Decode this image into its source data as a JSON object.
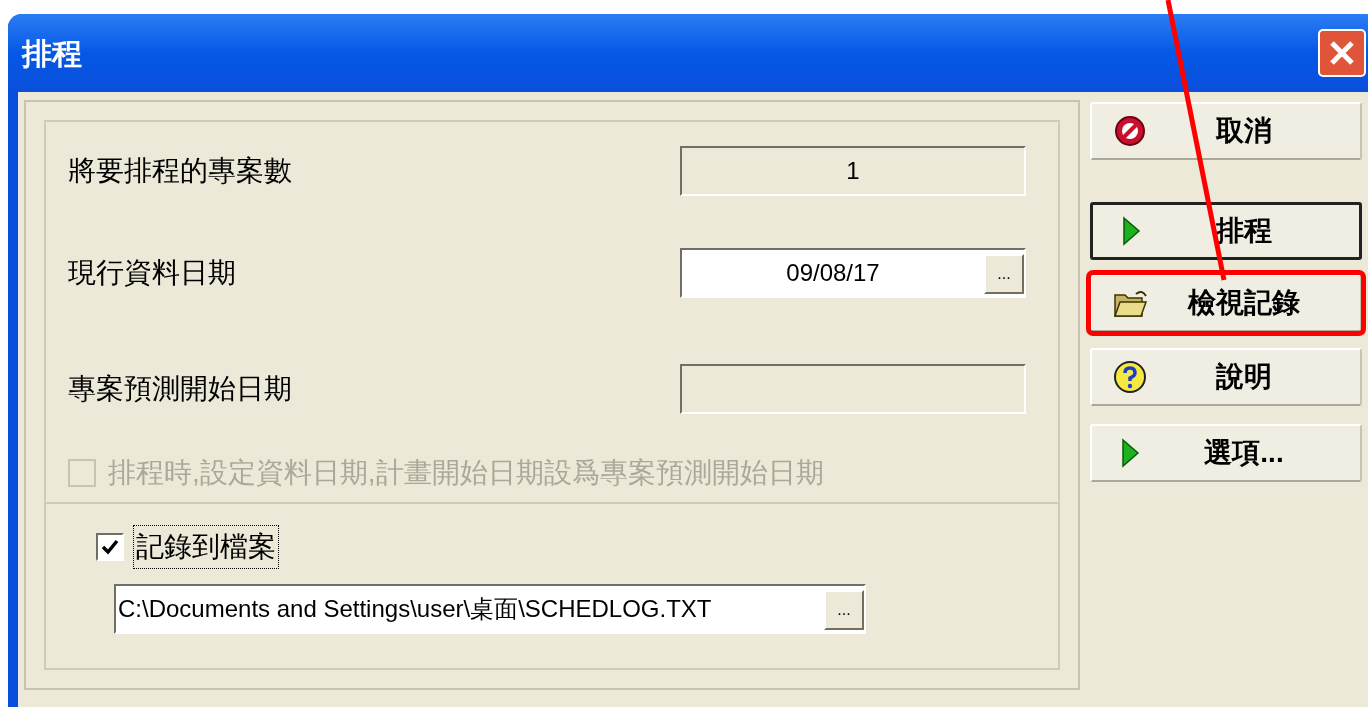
{
  "window": {
    "title": "排程"
  },
  "fields": [
    {
      "label": "將要排程的專案數",
      "value": "1",
      "editable": false,
      "browse": false
    },
    {
      "label": "現行資料日期",
      "value": "09/08/17",
      "editable": true,
      "browse": true
    },
    {
      "label": "專案預測開始日期",
      "editable": false,
      "browse": false
    }
  ],
  "checkboxes": [
    {
      "label": "排程時,設定資料日期,計畫開始日期設爲專案預測開始日期",
      "checked": false,
      "disabled": true,
      "focused": false
    },
    {
      "label": "記錄到檔案",
      "checked": true,
      "disabled": false,
      "focused": true
    }
  ],
  "log_path": {
    "value": "C:\\Documents and Settings\\user\\桌面\\SCHEDLOG.TXT",
    "browse_label": "..."
  },
  "browse_label": "...",
  "buttons": [
    {
      "label": "取消",
      "kind": "cancel",
      "default": false,
      "highlighted": false
    },
    {
      "label": "排程",
      "kind": "run",
      "default": true,
      "highlighted": false
    },
    {
      "label": "檢視記錄",
      "kind": "open",
      "default": false,
      "highlighted": true
    },
    {
      "label": "說明",
      "kind": "help",
      "default": false,
      "highlighted": false
    },
    {
      "label": "選項...",
      "kind": "run",
      "default": false,
      "highlighted": false
    }
  ]
}
